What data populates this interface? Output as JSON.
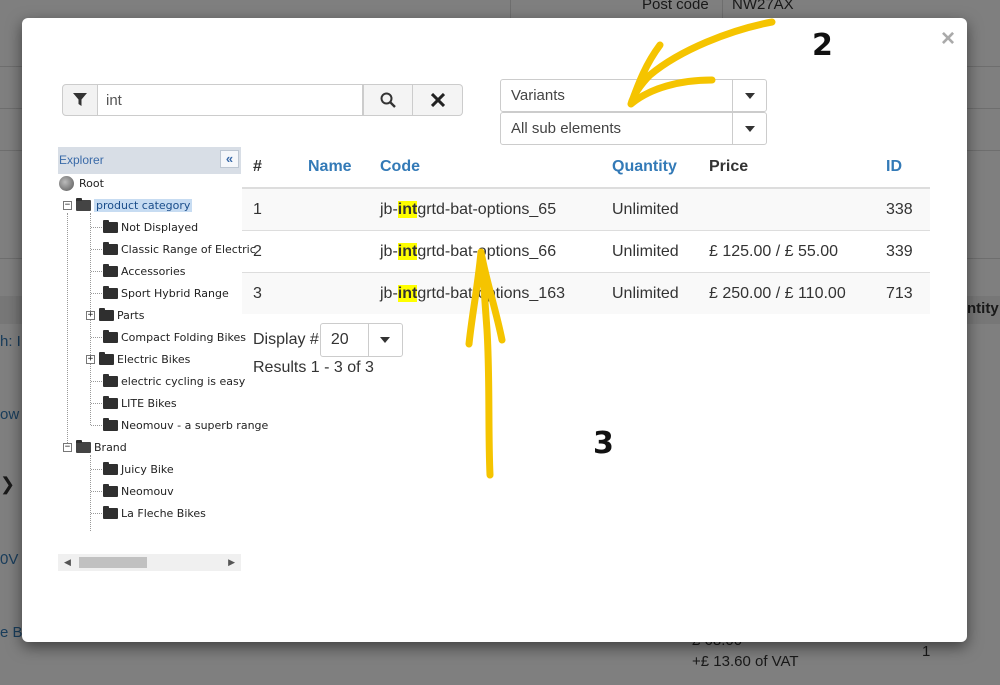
{
  "background": {
    "postcode_label": "Post code",
    "postcode_value": "NW27AX",
    "partial_text_1": "h: I",
    "partial_text_2": "ow s",
    "partial_text_3": "0V",
    "partial_text_4": "e B",
    "partial_text_5": "ntity",
    "price_partial": "£ 68.00",
    "vat_text": "+£ 13.60 of VAT",
    "qty_value": "1"
  },
  "modal": {
    "close_label": "×",
    "search": {
      "value": "int",
      "filter_icon": "filter-icon",
      "search_icon": "search-icon",
      "clear_icon": "clear-icon"
    },
    "type_select": {
      "value": "Variants"
    },
    "scope_select": {
      "value": "All sub elements"
    },
    "explorer": {
      "title": "Explorer",
      "collapse_label": "«",
      "root": "Root",
      "product_category": "product category",
      "category_items": [
        "Not Displayed",
        "Classic Range of Electric",
        "Accessories",
        "Sport Hybrid Range",
        "Parts",
        "Compact Folding Bikes",
        "Electric Bikes",
        "electric cycling is easy",
        "LITE Bikes",
        "Neomouv - a superb range"
      ],
      "brand": "Brand",
      "brand_items": [
        "Juicy Bike",
        "Neomouv",
        "La Fleche Bikes"
      ]
    },
    "table": {
      "headers": [
        "#",
        "Name",
        "Code",
        "Quantity",
        "Price",
        "ID"
      ],
      "highlight": "int",
      "rows": [
        {
          "num": "1",
          "name": "",
          "code_pre": "jb-",
          "code_post": "grtd-bat-options_65",
          "quantity": "Unlimited",
          "price": "",
          "id": "338"
        },
        {
          "num": "2",
          "name": "",
          "code_pre": "jb-",
          "code_post": "grtd-bat-options_66",
          "quantity": "Unlimited",
          "price": "£ 125.00 / £ 55.00",
          "id": "339"
        },
        {
          "num": "3",
          "name": "",
          "code_pre": "jb-",
          "code_post": "grtd-bat-options_163",
          "quantity": "Unlimited",
          "price": "£ 250.00 / £ 110.00",
          "id": "713"
        }
      ]
    },
    "display_label": "Display #",
    "display_value": "20",
    "results_text": "Results 1 - 3 of 3"
  },
  "annotations": {
    "label_2": "2",
    "label_3": "3",
    "color": "#f5c400"
  }
}
